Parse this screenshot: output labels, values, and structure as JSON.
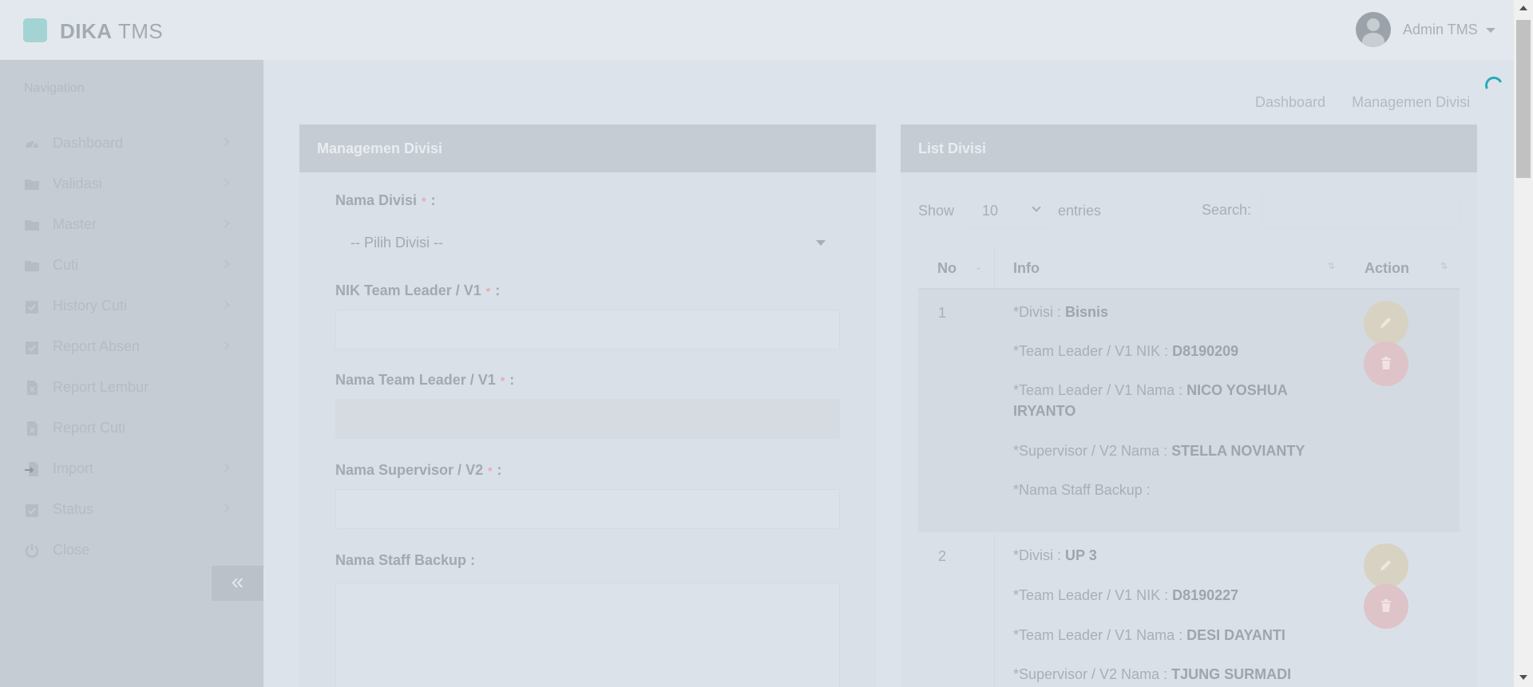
{
  "app": {
    "brand_bold": "DIKA",
    "brand_light": "TMS",
    "user_name": "Admin TMS"
  },
  "sidebar": {
    "nav_title": "Navigation",
    "items": [
      {
        "label": "Dashboard",
        "icon": "dashboard-icon",
        "has_children": true
      },
      {
        "label": "Validasi",
        "icon": "folder-icon",
        "has_children": true
      },
      {
        "label": "Master",
        "icon": "folder-icon",
        "has_children": true
      },
      {
        "label": "Cuti",
        "icon": "folder-icon",
        "has_children": true
      },
      {
        "label": "History Cuti",
        "icon": "calendar-check-icon",
        "has_children": true
      },
      {
        "label": "Report Absen",
        "icon": "calendar-check-icon",
        "has_children": true
      },
      {
        "label": "Report Lembur",
        "icon": "excel-file-icon",
        "has_children": false
      },
      {
        "label": "Report Cuti",
        "icon": "excel-file-icon",
        "has_children": false
      },
      {
        "label": "Import",
        "icon": "file-import-icon",
        "has_children": true
      },
      {
        "label": "Status",
        "icon": "calendar-check-icon",
        "has_children": true
      },
      {
        "label": "Close",
        "icon": "power-icon",
        "has_children": false
      }
    ],
    "collapse_symbol": "«"
  },
  "breadcrumb": [
    "Dashboard",
    "Managemen Divisi"
  ],
  "form_panel": {
    "title": "Managemen Divisi",
    "fields": {
      "nama_divisi": {
        "label": "Nama Divisi",
        "suffix": ":",
        "required": true,
        "selected": "-- Pilih Divisi --"
      },
      "nik_team_leader": {
        "label": "NIK Team Leader / V1",
        "suffix": ":",
        "required": true,
        "value": ""
      },
      "nama_team_leader": {
        "label": "Nama Team Leader / V1",
        "suffix": ":",
        "required": true,
        "value": ""
      },
      "nama_supervisor": {
        "label": "Nama Supervisor / V2",
        "suffix": ":",
        "required": true,
        "value": ""
      },
      "nama_staff_backup": {
        "label": "Nama Staff Backup :",
        "value": ""
      }
    },
    "required_mark": "*"
  },
  "list_panel": {
    "title": "List Divisi",
    "show_label": "Show",
    "page_length": "10",
    "entries_label": "entries",
    "search_label": "Search:",
    "search_value": "",
    "columns": [
      "No",
      "Info",
      "Action"
    ],
    "info_labels": {
      "divisi": "*Divisi : ",
      "tl_nik": "*Team Leader / V1 NIK : ",
      "tl_nama": "*Team Leader / V1 Nama : ",
      "spv_nama": "*Supervisor / V2 Nama : ",
      "staff_backup": "*Nama Staff Backup : "
    },
    "rows": [
      {
        "no": "1",
        "divisi": "Bisnis",
        "tl_nik": "D8190209",
        "tl_nama": "NICO YOSHUA IRYANTO",
        "spv_nama": "STELLA NOVIANTY",
        "staff_backup": ""
      },
      {
        "no": "2",
        "divisi": "UP 3",
        "tl_nik": "D8190227",
        "tl_nama": "DESI DAYANTI",
        "spv_nama": "TJUNG SURMADI",
        "staff_backup": ""
      }
    ]
  },
  "colors": {
    "accent": "#2ab0b0",
    "edit_button": "#d8d2c3",
    "delete_button": "#dec3c9"
  }
}
